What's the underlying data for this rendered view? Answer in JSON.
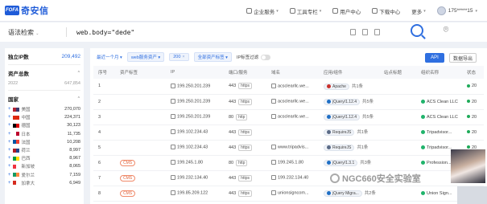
{
  "brand": {
    "logo_mark": "FOFA",
    "name": "奇安信"
  },
  "nav": {
    "items": [
      {
        "label": "企业服务"
      },
      {
        "label": "工具专栏"
      },
      {
        "label": "用户中心"
      },
      {
        "label": "下载中心"
      },
      {
        "label": "更多"
      }
    ],
    "user": "175*****15"
  },
  "search": {
    "type_label": "语法检索",
    "query": "web.body=\"dede\""
  },
  "left_panel": {
    "independent_ip": {
      "label": "独立IP数",
      "value": "209,492"
    },
    "asset_total": {
      "label": "资产总数"
    },
    "asset_year": {
      "label": "2022",
      "value": "647,854"
    },
    "country_head": {
      "label": "国家"
    },
    "countries": [
      {
        "name": "美国",
        "count": "270,070",
        "flag": [
          "#b22234",
          "#3c3b6e"
        ]
      },
      {
        "name": "中国",
        "count": "224,371",
        "flag": [
          "#de2910",
          "#de2910"
        ]
      },
      {
        "name": "德国",
        "count": "30,123",
        "flag": [
          "#000000",
          "#dd0000"
        ]
      },
      {
        "name": "日本",
        "count": "11,735",
        "flag": [
          "#ffffff",
          "#bc002d"
        ]
      },
      {
        "name": "法国",
        "count": "10,208",
        "flag": [
          "#0055a4",
          "#ef4135"
        ]
      },
      {
        "name": "荷兰",
        "count": "8,997",
        "flag": [
          "#ae1c28",
          "#21468b"
        ]
      },
      {
        "name": "巴西",
        "count": "8,967",
        "flag": [
          "#009c3b",
          "#ffdf00"
        ]
      },
      {
        "name": "新加坡",
        "count": "8,065",
        "flag": [
          "#ef3340",
          "#ffffff"
        ]
      },
      {
        "name": "爱尔兰",
        "count": "7,159",
        "flag": [
          "#169b62",
          "#ff883e"
        ]
      },
      {
        "name": "加拿大",
        "count": "6,949",
        "flag": [
          "#d52b1e",
          "#ffffff"
        ]
      }
    ]
  },
  "filters": {
    "recent": "最近一个月",
    "tags": [
      "web服务资产",
      "200",
      "全部资产标签"
    ],
    "ipv6_label": "IP标签过滤",
    "api_label": "API",
    "export_label": "数据导出"
  },
  "table": {
    "columns": [
      "序号",
      "资产标签",
      "IP",
      "端口/服务",
      "域名",
      "应用/组件",
      "站点标题",
      "组织名称",
      "状态"
    ],
    "rows": [
      {
        "n": "1",
        "tag": "",
        "ip": "199.250.201.239",
        "port": "443",
        "proto": "https",
        "domain": "acsclearllc.we...",
        "app": "Apache",
        "app_color": "#c9302c",
        "more": "共1条",
        "org": "",
        "status": "20"
      },
      {
        "n": "2",
        "tag": "",
        "ip": "199.250.201.239",
        "port": "443",
        "proto": "https",
        "domain": "acsclearllc.we...",
        "app": "jQuery/1.12.4",
        "app_color": "#1f6fc5",
        "more": "共5条",
        "org": "ACS Clean LLC",
        "status": "20"
      },
      {
        "n": "3",
        "tag": "",
        "ip": "199.250.201.239",
        "port": "80",
        "proto": "http",
        "domain": "acsclearllc.we...",
        "app": "jQuery/1.12.4",
        "app_color": "#1f6fc5",
        "more": "共5条",
        "org": "ACS Clean LLC",
        "status": "20"
      },
      {
        "n": "4",
        "tag": "",
        "ip": "199.102.234.43",
        "port": "443",
        "proto": "https",
        "domain": "",
        "app": "RequireJS",
        "app_color": "#5b6b86",
        "more": "共1条",
        "org": "Tripadvisor...",
        "status": "20"
      },
      {
        "n": "5",
        "tag": "",
        "ip": "199.102.234.43",
        "port": "443",
        "proto": "https",
        "domain": "www.tripadvis...",
        "app": "RequireJS",
        "app_color": "#5b6b86",
        "more": "共1条",
        "org": "Tripadvisor...",
        "status": "20"
      },
      {
        "n": "6",
        "tag": "CMS",
        "ip": "199.245.1.80",
        "port": "80",
        "proto": "http",
        "domain": "199.245.1.80",
        "app": "jQuery/1.3.1",
        "app_color": "#1f6fc5",
        "more": "共3条",
        "org": "Profession...",
        "status": "20"
      },
      {
        "n": "7",
        "tag": "CMS",
        "ip": "199.232.134.40",
        "port": "443",
        "proto": "https",
        "domain": "199.232.134.40",
        "app": "",
        "app_color": "",
        "more": "",
        "org": "",
        "status": "20"
      },
      {
        "n": "8",
        "tag": "CMS",
        "ip": "199.85.209.122",
        "port": "443",
        "proto": "https",
        "domain": "unionsigncom...",
        "app": "jQuery Migra...",
        "app_color": "#1f6fc5",
        "more": "共2条",
        "org": "Union Sign...",
        "status": "20"
      }
    ]
  },
  "watermark": "NGC660安全实验室"
}
